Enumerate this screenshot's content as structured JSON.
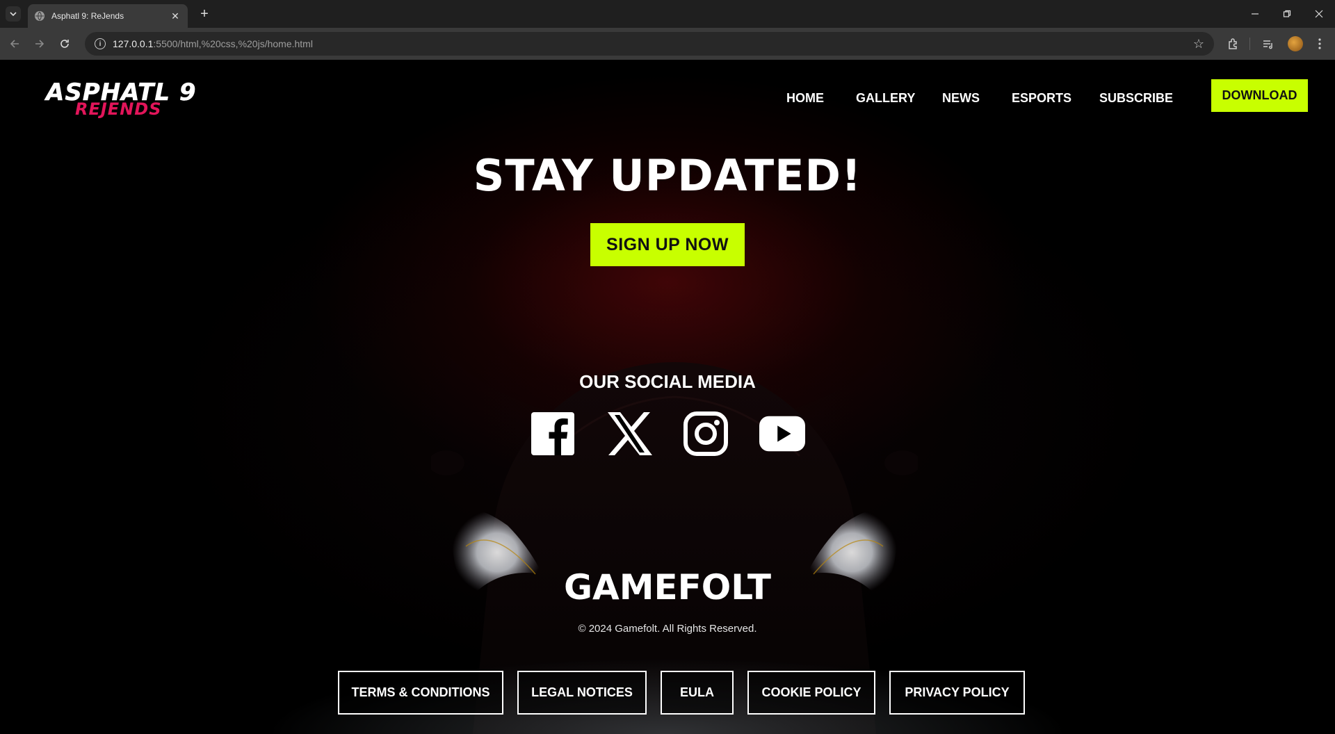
{
  "browser": {
    "tab_title": "Asphatl 9: ReJends",
    "url_host": "127.0.0.1",
    "url_path": ":5500/html,%20css,%20js/home.html"
  },
  "header": {
    "logo_line1": "ASPHATL 9",
    "logo_line2": "REJENDS",
    "nav": [
      "HOME",
      "GALLERY",
      "NEWS",
      "ESPORTS",
      "SUBSCRIBE"
    ],
    "download_label": "DOWNLOAD"
  },
  "hero": {
    "headline": "STAY UPDATED!",
    "signup_label": "SIGN UP NOW"
  },
  "social": {
    "title": "OUR SOCIAL MEDIA",
    "icons": [
      "facebook-icon",
      "x-icon",
      "instagram-icon",
      "youtube-icon"
    ]
  },
  "footer": {
    "brand": "GAMEFOLT",
    "copyright": "© 2024 Gamefolt. All Rights Reserved.",
    "links": [
      "TERMS & CONDITIONS",
      "LEGAL NOTICES",
      "EULA",
      "COOKIE POLICY",
      "PRIVACY POLICY"
    ]
  },
  "colors": {
    "accent": "#c8ff00",
    "logo_red": "#e2155a",
    "background": "#000000"
  }
}
